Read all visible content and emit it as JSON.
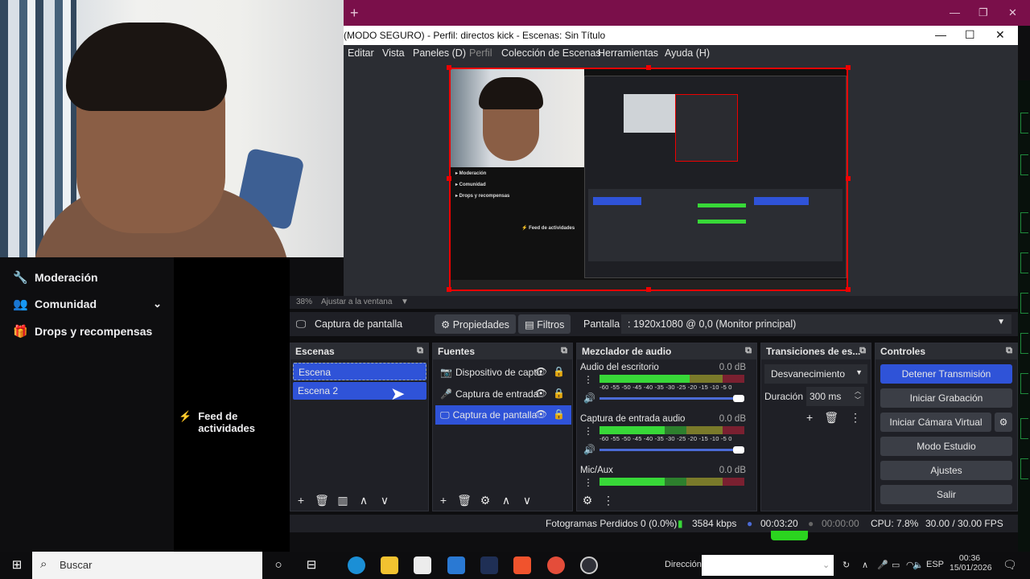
{
  "obs": {
    "title": "(MODO SEGURO) - Perfil: directos kick - Escenas: Sin Título",
    "menu": [
      "Editar",
      "Vista",
      "Paneles (D)",
      "Perfil",
      "Colección de Escenas",
      "Herramientas",
      "Ayuda (H)"
    ],
    "zoom": "38%",
    "zoom_mode": "Ajustar a la ventana",
    "source_name": "Captura de pantalla",
    "properties_label": "Propiedades",
    "filters_label": "Filtros",
    "display_label": "Pantalla",
    "display_value": ": 1920x1080 @ 0,0 (Monitor principal)",
    "scenes": {
      "title": "Escenas",
      "items": [
        "Escena",
        "Escena 2"
      ]
    },
    "sources": {
      "title": "Fuentes",
      "items": [
        "Dispositivo de captu",
        "Captura de entrada",
        "Captura de pantalla"
      ]
    },
    "mixer": {
      "title": "Mezclador de audio",
      "channels": [
        {
          "name": "Audio del escritorio",
          "db": "0.0 dB",
          "level": 0.62
        },
        {
          "name": "Captura de entrada audio",
          "db": "0.0 dB",
          "level": 0.45
        },
        {
          "name": "Mic/Aux",
          "db": "0.0 dB",
          "level": 0.45
        }
      ],
      "scale": "-60 -55 -50 -45 -40 -35 -30 -25 -20 -15 -10 -5   0"
    },
    "transitions": {
      "title": "Transiciones de es...",
      "current": "Desvanecimiento",
      "duration_label": "Duración",
      "duration_value": "300 ms"
    },
    "controls": {
      "title": "Controles",
      "stop_stream": "Detener Transmisión",
      "start_record": "Iniciar Grabación",
      "start_vcam": "Iniciar Cámara Virtual",
      "studio_mode": "Modo Estudio",
      "settings": "Ajustes",
      "exit": "Salir"
    },
    "status": {
      "dropped": "Fotogramas Perdidos 0 (0.0%)",
      "bitrate": "3584 kbps",
      "stream_time": "00:03:20",
      "rec_time": "00:00:00",
      "cpu": "CPU: 7.8%",
      "fps": "30.00 / 30.00 FPS"
    }
  },
  "twitch": {
    "moderation": "Moderación",
    "community": "Comunidad",
    "drops": "Drops y recompensas",
    "feed": "Feed de actividades"
  },
  "taskbar": {
    "search": "Buscar",
    "address_label": "Dirección",
    "lang": "ESP",
    "time": "00:36",
    "date": "15/01/2026"
  },
  "colors": {
    "accent": "#2f53d8",
    "titlebar_bg": "#7a0f4a",
    "stream_green": "#2bd41f"
  }
}
